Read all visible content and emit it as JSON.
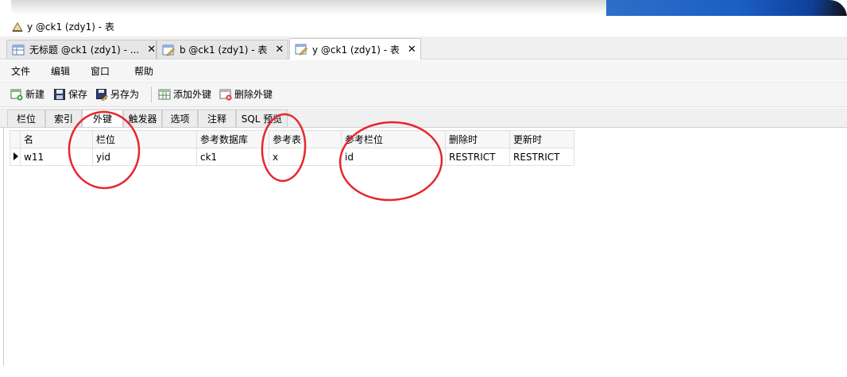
{
  "window": {
    "title": "y @ck1 (zdy1) - 表"
  },
  "tabs": [
    {
      "label": "无标题 @ck1 (zdy1) - ..."
    },
    {
      "label": "b @ck1 (zdy1) - 表"
    },
    {
      "label": "y @ck1 (zdy1) - 表"
    }
  ],
  "menu": {
    "file": "文件",
    "edit": "编辑",
    "window": "窗口",
    "help": "帮助"
  },
  "toolbar": {
    "new": "新建",
    "save": "保存",
    "save_as": "另存为",
    "add_fk": "添加外键",
    "delete_fk": "删除外键"
  },
  "subtabs": [
    "栏位",
    "索引",
    "外键",
    "触发器",
    "选项",
    "注释",
    "SQL 预览"
  ],
  "grid": {
    "headers": [
      "名",
      "栏位",
      "参考数据库",
      "参考表",
      "参考栏位",
      "删除时",
      "更新时"
    ],
    "rows": [
      [
        "w11",
        "yid",
        "ck1",
        "x",
        "id",
        "RESTRICT",
        "RESTRICT"
      ]
    ]
  },
  "colors": {
    "accent_blue": "#1b5fc4",
    "annotation_red": "#e8262d"
  }
}
